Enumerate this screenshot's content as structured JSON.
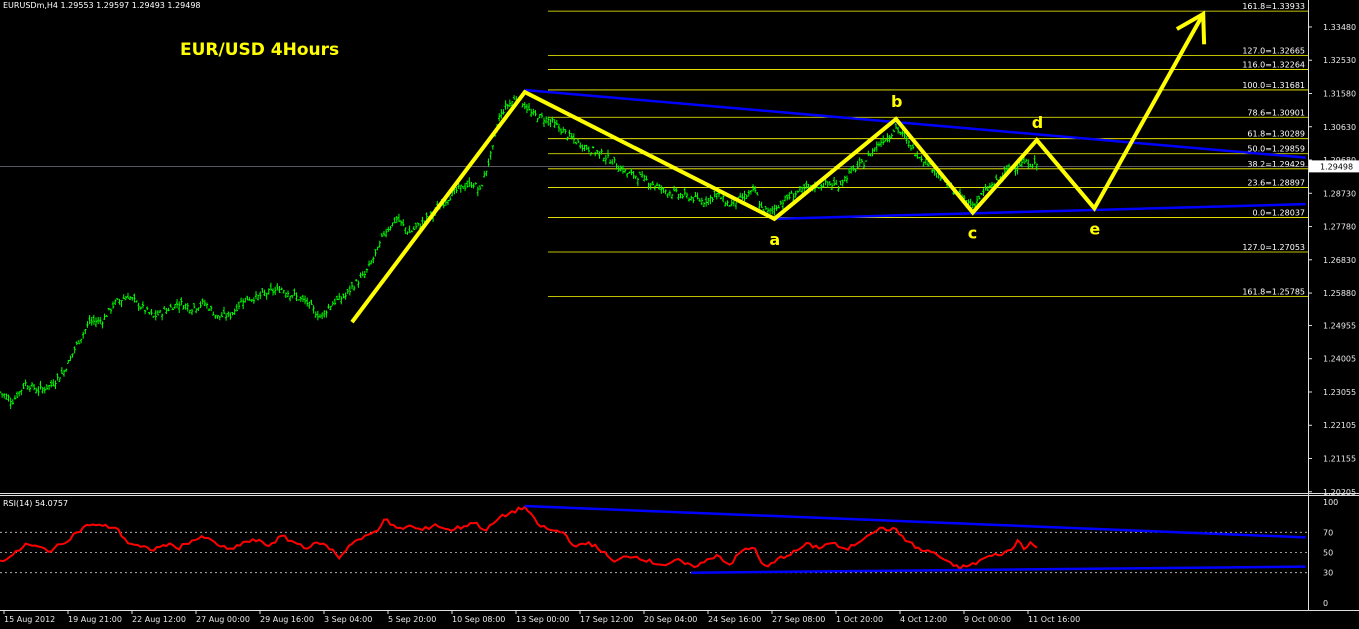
{
  "header": {
    "symbol_info": "EURUSDm,H4  1.29553 1.29597 1.29493 1.29498"
  },
  "title": "EUR/USD 4Hours",
  "rsi_label": "RSI(14) 54.0757",
  "current_price_label": "1.29498",
  "colors": {
    "background": "#000000",
    "candles": "#00ff00",
    "wave": "#ffff00",
    "trendline": "#0000ff",
    "fib": "#ffff00",
    "rsi": "#ff0000",
    "title": "#ffff00"
  },
  "chart_data": [
    {
      "type": "candlestick",
      "title": "EUR/USD 4Hours",
      "ylim": [
        1.2017,
        1.3425
      ],
      "price_ticks": [
        "1.33480",
        "1.32530",
        "1.31580",
        "1.30630",
        "1.29680",
        "1.28730",
        "1.27780",
        "1.26830",
        "1.25880",
        "1.24955",
        "1.24005",
        "1.23055",
        "1.22105",
        "1.21155",
        "1.20205"
      ],
      "time_labels": [
        "15 Aug 2012",
        "19 Aug 21:00",
        "22 Aug 12:00",
        "27 Aug 00:00",
        "29 Aug 16:00",
        "3 Sep 04:00",
        "5 Sep 20:00",
        "10 Sep 08:00",
        "13 Sep 00:00",
        "17 Sep 12:00",
        "20 Sep 04:00",
        "24 Sep 16:00",
        "27 Sep 08:00",
        "1 Oct 20:00",
        "4 Oct 12:00",
        "9 Oct 00:00",
        "11 Oct 16:00"
      ],
      "close_path": [
        [
          0,
          1.2305
        ],
        [
          2,
          1.228
        ],
        [
          4,
          1.233
        ],
        [
          6,
          1.231
        ],
        [
          8,
          1.2325
        ],
        [
          10,
          1.2365
        ],
        [
          12,
          1.244
        ],
        [
          14,
          1.2505
        ],
        [
          16,
          1.251
        ],
        [
          18,
          1.256
        ],
        [
          20,
          1.258
        ],
        [
          22,
          1.255
        ],
        [
          24,
          1.252
        ],
        [
          26,
          1.254
        ],
        [
          28,
          1.256
        ],
        [
          30,
          1.2545
        ],
        [
          32,
          1.256
        ],
        [
          34,
          1.252
        ],
        [
          36,
          1.2525
        ],
        [
          38,
          1.257
        ],
        [
          40,
          1.2575
        ],
        [
          42,
          1.259
        ],
        [
          44,
          1.26
        ],
        [
          46,
          1.258
        ],
        [
          48,
          1.256
        ],
        [
          50,
          1.252
        ],
        [
          52,
          1.256
        ],
        [
          54,
          1.258
        ],
        [
          55,
          1.2605
        ],
        [
          57,
          1.264
        ],
        [
          59,
          1.271
        ],
        [
          60,
          1.276
        ],
        [
          62,
          1.28
        ],
        [
          64,
          1.276
        ],
        [
          66,
          1.279
        ],
        [
          68,
          1.282
        ],
        [
          70,
          1.286
        ],
        [
          72,
          1.289
        ],
        [
          74,
          1.29
        ],
        [
          75,
          1.288
        ],
        [
          77,
          1.3
        ],
        [
          78,
          1.309
        ],
        [
          79,
          1.312
        ],
        [
          81,
          1.315
        ],
        [
          83,
          1.31
        ],
        [
          86,
          1.308
        ],
        [
          88,
          1.305
        ],
        [
          90,
          1.302
        ],
        [
          92,
          1.3
        ],
        [
          94,
          1.2985
        ],
        [
          96,
          1.296
        ],
        [
          98,
          1.293
        ],
        [
          100,
          1.292
        ],
        [
          102,
          1.29
        ],
        [
          104,
          1.288
        ],
        [
          106,
          1.287
        ],
        [
          108,
          1.286
        ],
        [
          110,
          1.285
        ],
        [
          112,
          1.287
        ],
        [
          114,
          1.284
        ],
        [
          116,
          1.286
        ],
        [
          118,
          1.288
        ],
        [
          119,
          1.283
        ],
        [
          120,
          1.282
        ],
        [
          121,
          1.283
        ],
        [
          123,
          1.286
        ],
        [
          125,
          1.288
        ],
        [
          127,
          1.289
        ],
        [
          129,
          1.29
        ],
        [
          131,
          1.2895
        ],
        [
          133,
          1.2935
        ],
        [
          135,
          1.296
        ],
        [
          137,
          1.301
        ],
        [
          139,
          1.304
        ],
        [
          140,
          1.306
        ],
        [
          141,
          1.304
        ],
        [
          143,
          1.299
        ],
        [
          145,
          1.296
        ],
        [
          147,
          1.292
        ],
        [
          149,
          1.288
        ],
        [
          151,
          1.285
        ],
        [
          152,
          1.284
        ],
        [
          154,
          1.288
        ],
        [
          156,
          1.291
        ],
        [
          158,
          1.295
        ],
        [
          160,
          1.296
        ],
        [
          162,
          1.2955
        ]
      ],
      "fibonacci_levels": [
        {
          "label": "161.8=1.33933",
          "price": 1.33933
        },
        {
          "label": "127.0=1.32665",
          "price": 1.32665
        },
        {
          "label": "116.0=1.32264",
          "price": 1.32264
        },
        {
          "label": "100.0=1.31681",
          "price": 1.31681
        },
        {
          "label": "78.6=1.30901",
          "price": 1.30901
        },
        {
          "label": "61.8=1.30289",
          "price": 1.30289
        },
        {
          "label": "50.0=1.29859",
          "price": 1.29859
        },
        {
          "label": "38.2=1.29429",
          "price": 1.29429
        },
        {
          "label": "23.6=1.28897",
          "price": 1.28897
        },
        {
          "label": "0.0=1.28037",
          "price": 1.28037
        },
        {
          "label": "127.0=1.27053",
          "price": 1.27053
        },
        {
          "label": "161.8=1.25785",
          "price": 1.25785
        }
      ],
      "wave_points": [
        {
          "bar": 55,
          "price": 1.2505,
          "label": ""
        },
        {
          "bar": 82,
          "price": 1.3162,
          "label": ""
        },
        {
          "bar": 121,
          "price": 1.28,
          "label": "a"
        },
        {
          "bar": 140,
          "price": 1.3085,
          "label": "b"
        },
        {
          "bar": 152,
          "price": 1.2818,
          "label": "c"
        },
        {
          "bar": 162,
          "price": 1.3025,
          "label": "d"
        },
        {
          "bar": 171,
          "price": 1.283,
          "label": "e"
        },
        {
          "bar": 188,
          "price": 1.3385,
          "label": ""
        }
      ],
      "trendlines": [
        {
          "from": [
            82,
            1.3168
          ],
          "to": [
            204,
            1.2975
          ]
        },
        {
          "from": [
            121,
            1.28
          ],
          "to": [
            204,
            1.2842
          ]
        }
      ]
    },
    {
      "type": "line",
      "title": "RSI(14) 54.0757",
      "ylim": [
        0,
        100
      ],
      "levels": [
        30,
        50,
        70
      ],
      "y_ticks": [
        "100",
        "70",
        "50",
        "30",
        "0"
      ],
      "values": [
        [
          0,
          42
        ],
        [
          2,
          47
        ],
        [
          4,
          58
        ],
        [
          6,
          55
        ],
        [
          8,
          52
        ],
        [
          10,
          60
        ],
        [
          12,
          70
        ],
        [
          14,
          78
        ],
        [
          16,
          76
        ],
        [
          18,
          75
        ],
        [
          20,
          60
        ],
        [
          22,
          55
        ],
        [
          24,
          53
        ],
        [
          26,
          58
        ],
        [
          28,
          55
        ],
        [
          30,
          62
        ],
        [
          32,
          65
        ],
        [
          34,
          58
        ],
        [
          36,
          52
        ],
        [
          38,
          60
        ],
        [
          40,
          62
        ],
        [
          42,
          57
        ],
        [
          44,
          66
        ],
        [
          46,
          60
        ],
        [
          48,
          55
        ],
        [
          50,
          60
        ],
        [
          52,
          52
        ],
        [
          53,
          45
        ],
        [
          55,
          60
        ],
        [
          57,
          65
        ],
        [
          59,
          72
        ],
        [
          60,
          84
        ],
        [
          62,
          73
        ],
        [
          64,
          76
        ],
        [
          66,
          72
        ],
        [
          68,
          78
        ],
        [
          70,
          72
        ],
        [
          72,
          75
        ],
        [
          74,
          80
        ],
        [
          76,
          72
        ],
        [
          78,
          84
        ],
        [
          80,
          90
        ],
        [
          82,
          95
        ],
        [
          84,
          78
        ],
        [
          86,
          72
        ],
        [
          88,
          70
        ],
        [
          90,
          55
        ],
        [
          92,
          60
        ],
        [
          94,
          52
        ],
        [
          96,
          40
        ],
        [
          98,
          47
        ],
        [
          100,
          45
        ],
        [
          102,
          40
        ],
        [
          104,
          38
        ],
        [
          106,
          42
        ],
        [
          108,
          36
        ],
        [
          110,
          40
        ],
        [
          112,
          48
        ],
        [
          114,
          38
        ],
        [
          116,
          52
        ],
        [
          118,
          55
        ],
        [
          119,
          38
        ],
        [
          120,
          36
        ],
        [
          122,
          45
        ],
        [
          124,
          50
        ],
        [
          126,
          58
        ],
        [
          128,
          55
        ],
        [
          130,
          60
        ],
        [
          132,
          52
        ],
        [
          134,
          60
        ],
        [
          136,
          70
        ],
        [
          138,
          74
        ],
        [
          140,
          72
        ],
        [
          142,
          60
        ],
        [
          144,
          52
        ],
        [
          146,
          50
        ],
        [
          148,
          40
        ],
        [
          150,
          35
        ],
        [
          152,
          38
        ],
        [
          154,
          45
        ],
        [
          156,
          48
        ],
        [
          158,
          52
        ],
        [
          159,
          62
        ],
        [
          160,
          55
        ],
        [
          161,
          60
        ],
        [
          162,
          54
        ]
      ],
      "trendlines": [
        {
          "from": [
            82,
            96
          ],
          "to": [
            204,
            65
          ]
        },
        {
          "from": [
            108,
            30
          ],
          "to": [
            204,
            36
          ]
        }
      ]
    }
  ]
}
